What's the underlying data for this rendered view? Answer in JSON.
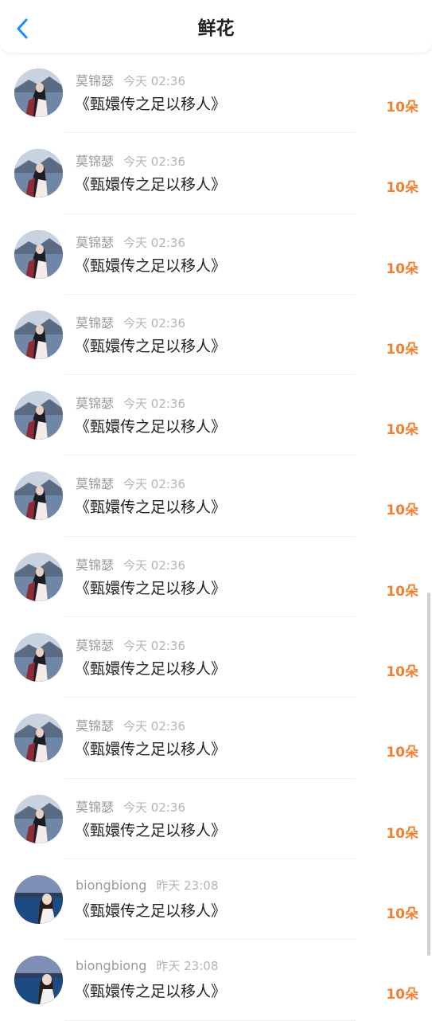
{
  "header": {
    "title": "鲜花",
    "back_icon": "chevron-left-icon",
    "accent": "#1a8cff"
  },
  "colors": {
    "amount": "#f08030",
    "book": "#222222",
    "username": "#9a9a9a"
  },
  "rows": [
    {
      "username": "莫锦瑟",
      "time": "今天 02:36",
      "book": "《甄嬛传之足以移人》",
      "amount": "10朵",
      "avatar": "avatar-woman"
    },
    {
      "username": "莫锦瑟",
      "time": "今天 02:36",
      "book": "《甄嬛传之足以移人》",
      "amount": "10朵",
      "avatar": "avatar-woman"
    },
    {
      "username": "莫锦瑟",
      "time": "今天 02:36",
      "book": "《甄嬛传之足以移人》",
      "amount": "10朵",
      "avatar": "avatar-woman"
    },
    {
      "username": "莫锦瑟",
      "time": "今天 02:36",
      "book": "《甄嬛传之足以移人》",
      "amount": "10朵",
      "avatar": "avatar-woman"
    },
    {
      "username": "莫锦瑟",
      "time": "今天 02:36",
      "book": "《甄嬛传之足以移人》",
      "amount": "10朵",
      "avatar": "avatar-woman"
    },
    {
      "username": "莫锦瑟",
      "time": "今天 02:36",
      "book": "《甄嬛传之足以移人》",
      "amount": "10朵",
      "avatar": "avatar-woman"
    },
    {
      "username": "莫锦瑟",
      "time": "今天 02:36",
      "book": "《甄嬛传之足以移人》",
      "amount": "10朵",
      "avatar": "avatar-woman"
    },
    {
      "username": "莫锦瑟",
      "time": "今天 02:36",
      "book": "《甄嬛传之足以移人》",
      "amount": "10朵",
      "avatar": "avatar-woman"
    },
    {
      "username": "莫锦瑟",
      "time": "今天 02:36",
      "book": "《甄嬛传之足以移人》",
      "amount": "10朵",
      "avatar": "avatar-woman"
    },
    {
      "username": "莫锦瑟",
      "time": "今天 02:36",
      "book": "《甄嬛传之足以移人》",
      "amount": "10朵",
      "avatar": "avatar-woman"
    },
    {
      "username": "biongbiong",
      "time": "昨天 23:08",
      "book": "《甄嬛传之足以移人》",
      "amount": "10朵",
      "avatar": "avatar-sea"
    },
    {
      "username": "biongbiong",
      "time": "昨天 23:08",
      "book": "《甄嬛传之足以移人》",
      "amount": "10朵",
      "avatar": "avatar-sea"
    }
  ]
}
